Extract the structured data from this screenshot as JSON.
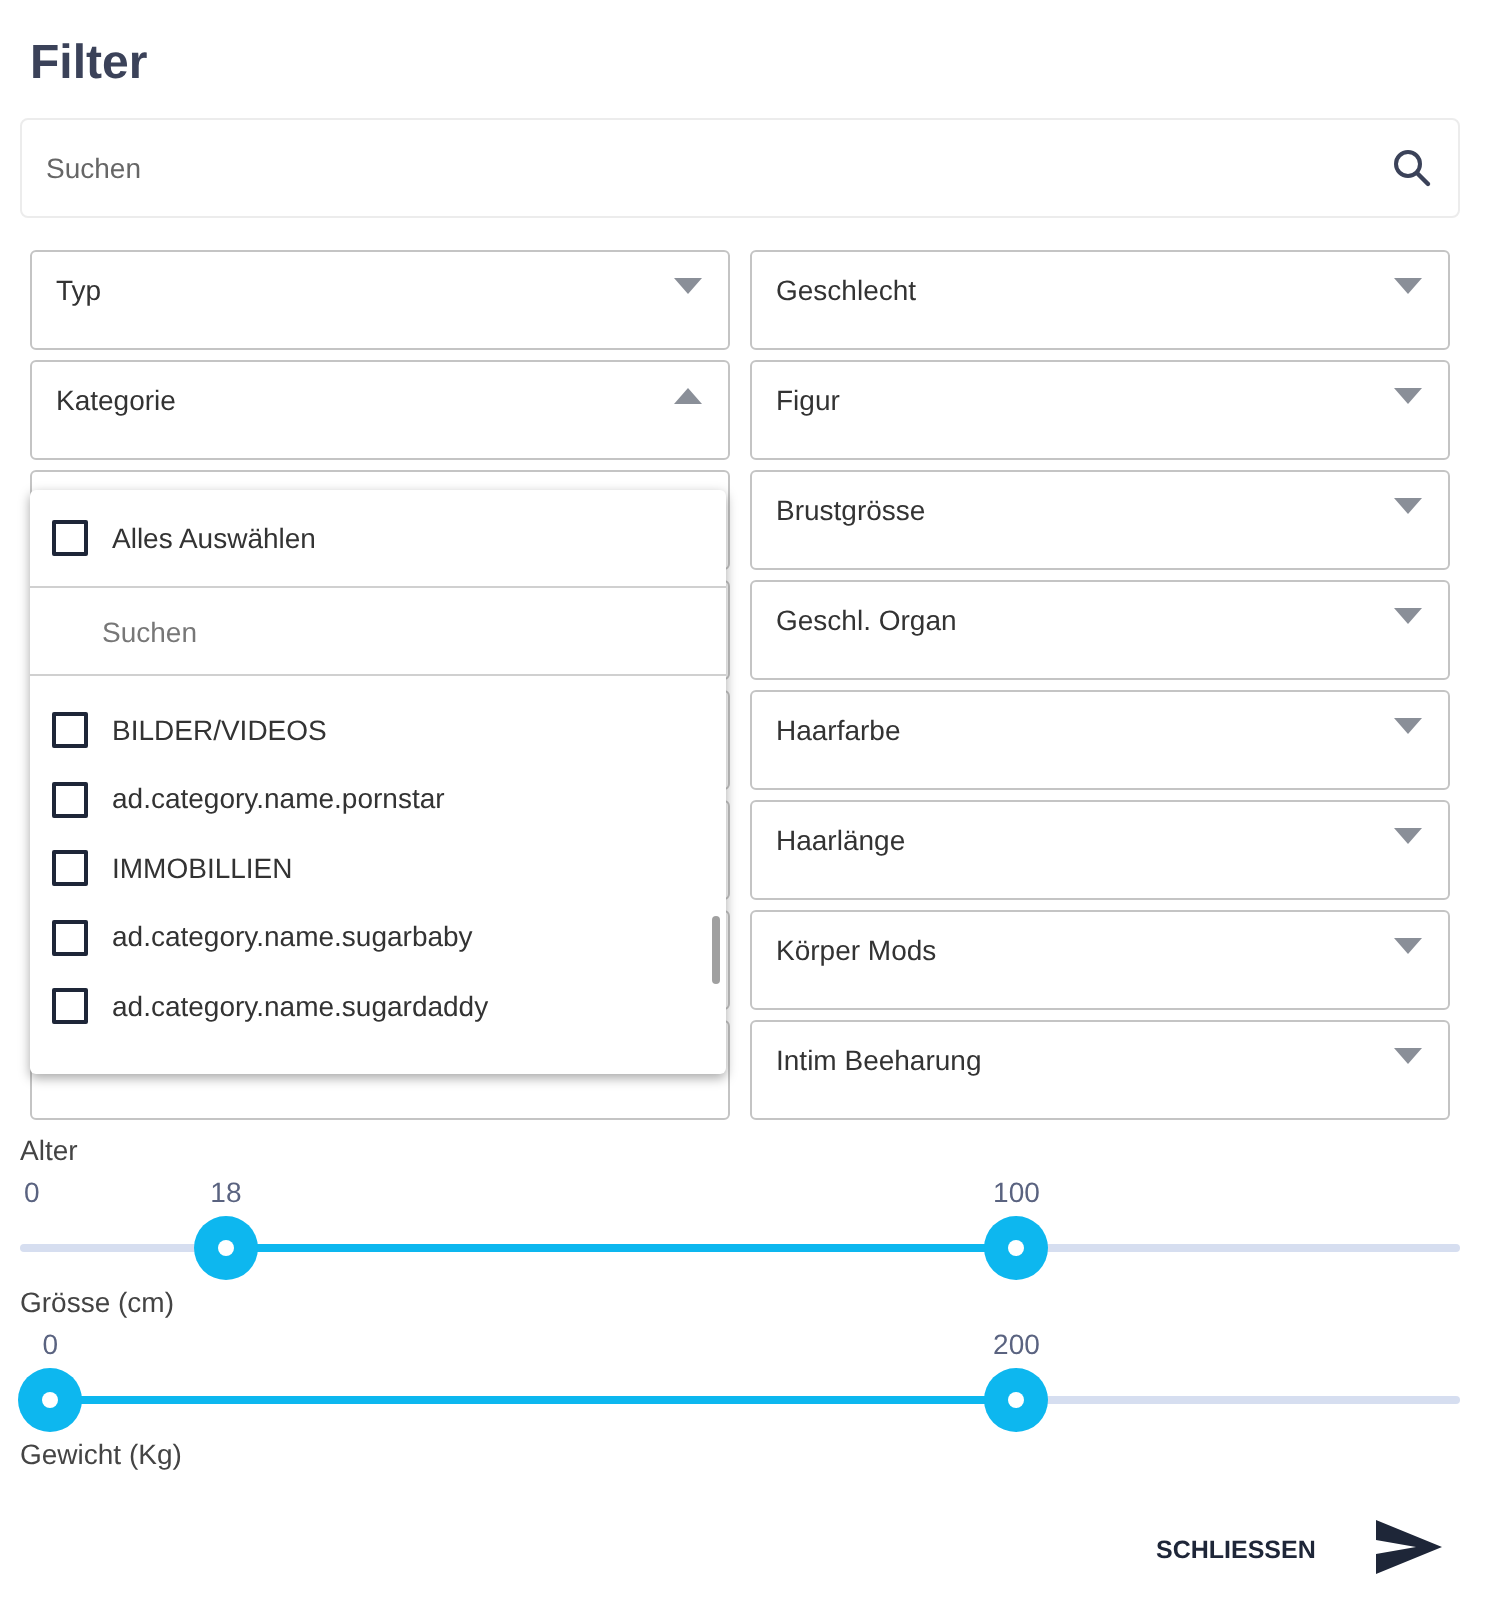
{
  "title": "Filter",
  "search": {
    "placeholder": "Suchen"
  },
  "selects_left": [
    {
      "label": "Typ",
      "expanded": false
    },
    {
      "label": "Kategorie",
      "expanded": true
    }
  ],
  "selects_right": [
    {
      "label": "Geschlecht",
      "expanded": false
    },
    {
      "label": "Figur",
      "expanded": false
    },
    {
      "label": "Brustgrösse",
      "expanded": false
    },
    {
      "label": "Geschl. Organ",
      "expanded": false
    },
    {
      "label": "Haarfarbe",
      "expanded": false
    },
    {
      "label": "Haarlänge",
      "expanded": false
    },
    {
      "label": "Körper Mods",
      "expanded": false
    },
    {
      "label": "Intim Beeharung",
      "expanded": false
    }
  ],
  "menu": {
    "select_all": {
      "label": "Alles Auswählen",
      "checked": false
    },
    "search": {
      "placeholder": "Suchen"
    },
    "options": [
      {
        "label": "BILDER/VIDEOS",
        "checked": false
      },
      {
        "label": "ad.category.name.pornstar",
        "checked": false
      },
      {
        "label": "IMMOBILLIEN",
        "checked": false
      },
      {
        "label": "ad.category.name.sugarbaby",
        "checked": false
      },
      {
        "label": "ad.category.name.sugardaddy",
        "checked": false
      }
    ]
  },
  "sliders": [
    {
      "label": "Alter",
      "min_label": "0",
      "thumbs": [
        {
          "value": "18"
        },
        {
          "value": "100"
        }
      ]
    },
    {
      "label": "Grösse (cm)",
      "thumbs": [
        {
          "value": "0"
        },
        {
          "value": "200"
        }
      ]
    }
  ],
  "next_label": "Gewicht (Kg)",
  "close_button": "SCHLIESSEN"
}
